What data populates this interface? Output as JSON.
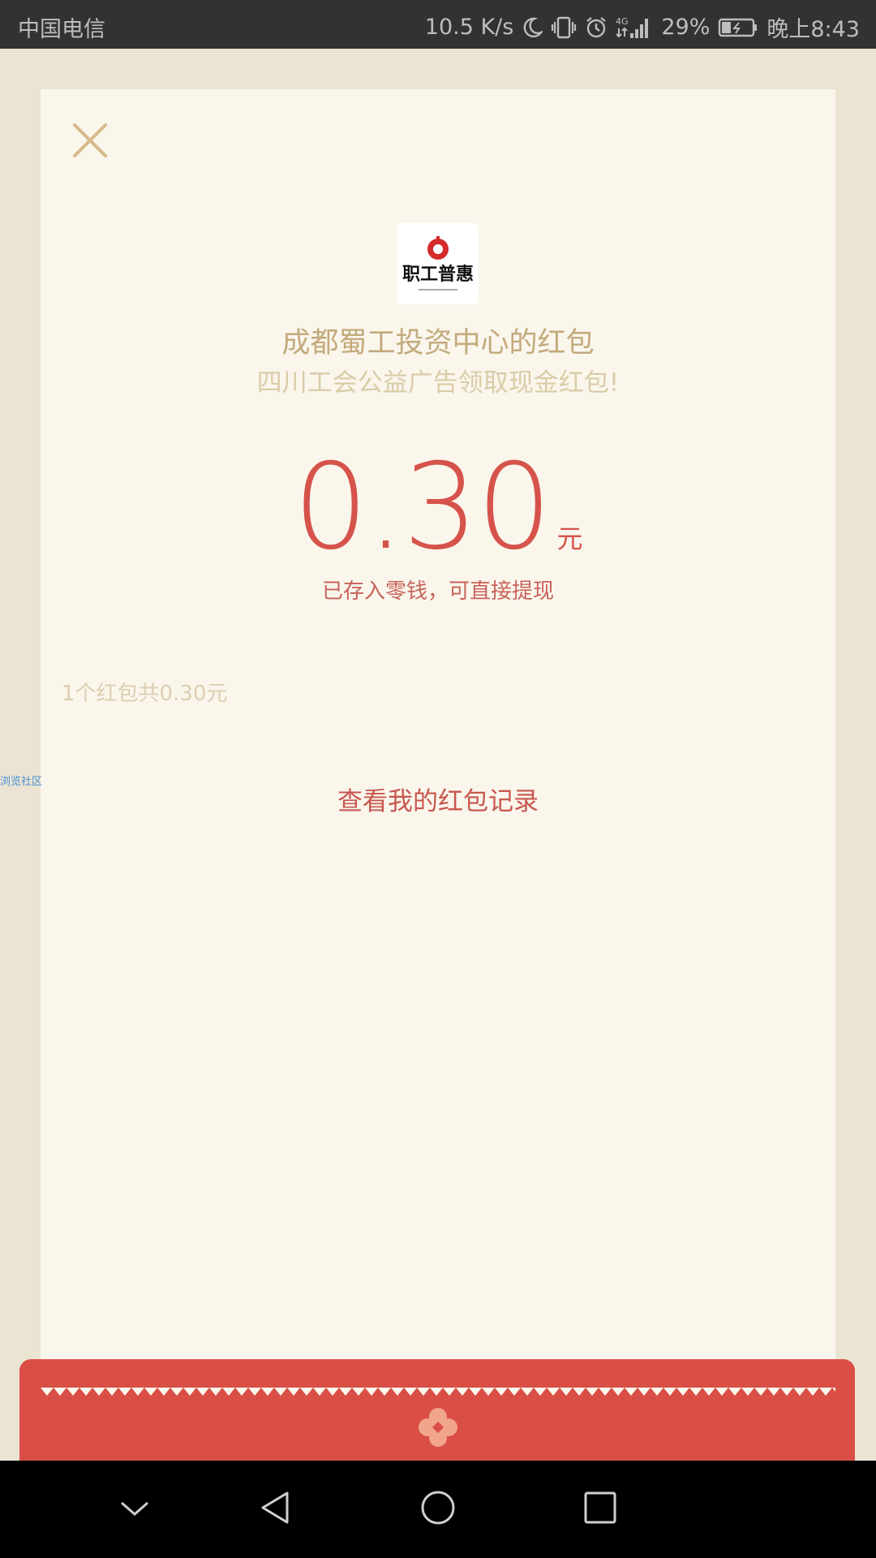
{
  "status_bar": {
    "carrier": "中国电信",
    "speed": "10.5 K/s",
    "network": "4G",
    "battery": "29%",
    "time": "晚上8:43",
    "icons": [
      "moon-icon",
      "vibrate-icon",
      "alarm-icon",
      "signal-icon",
      "battery-icon"
    ]
  },
  "red_packet": {
    "sender": "成都蜀工投资中心的红包",
    "wish": "四川工会公益广告领取现金红包!",
    "amount": "0.30",
    "unit": "元",
    "deposit_note": "已存入零钱，可直接提现",
    "summary": "1个红包共0.30元",
    "record_link": "查看我的红包记录",
    "logo_text": "职工普惠"
  },
  "side_tag": "浏览社区",
  "colors": {
    "background": "#ebe4d3",
    "card": "#faf6ec",
    "accent_red": "#d94f45",
    "gold": "#c3aa7c"
  },
  "nav_bar": {
    "icons": [
      "chevron-down-icon",
      "back-icon",
      "home-icon",
      "recents-icon"
    ]
  }
}
